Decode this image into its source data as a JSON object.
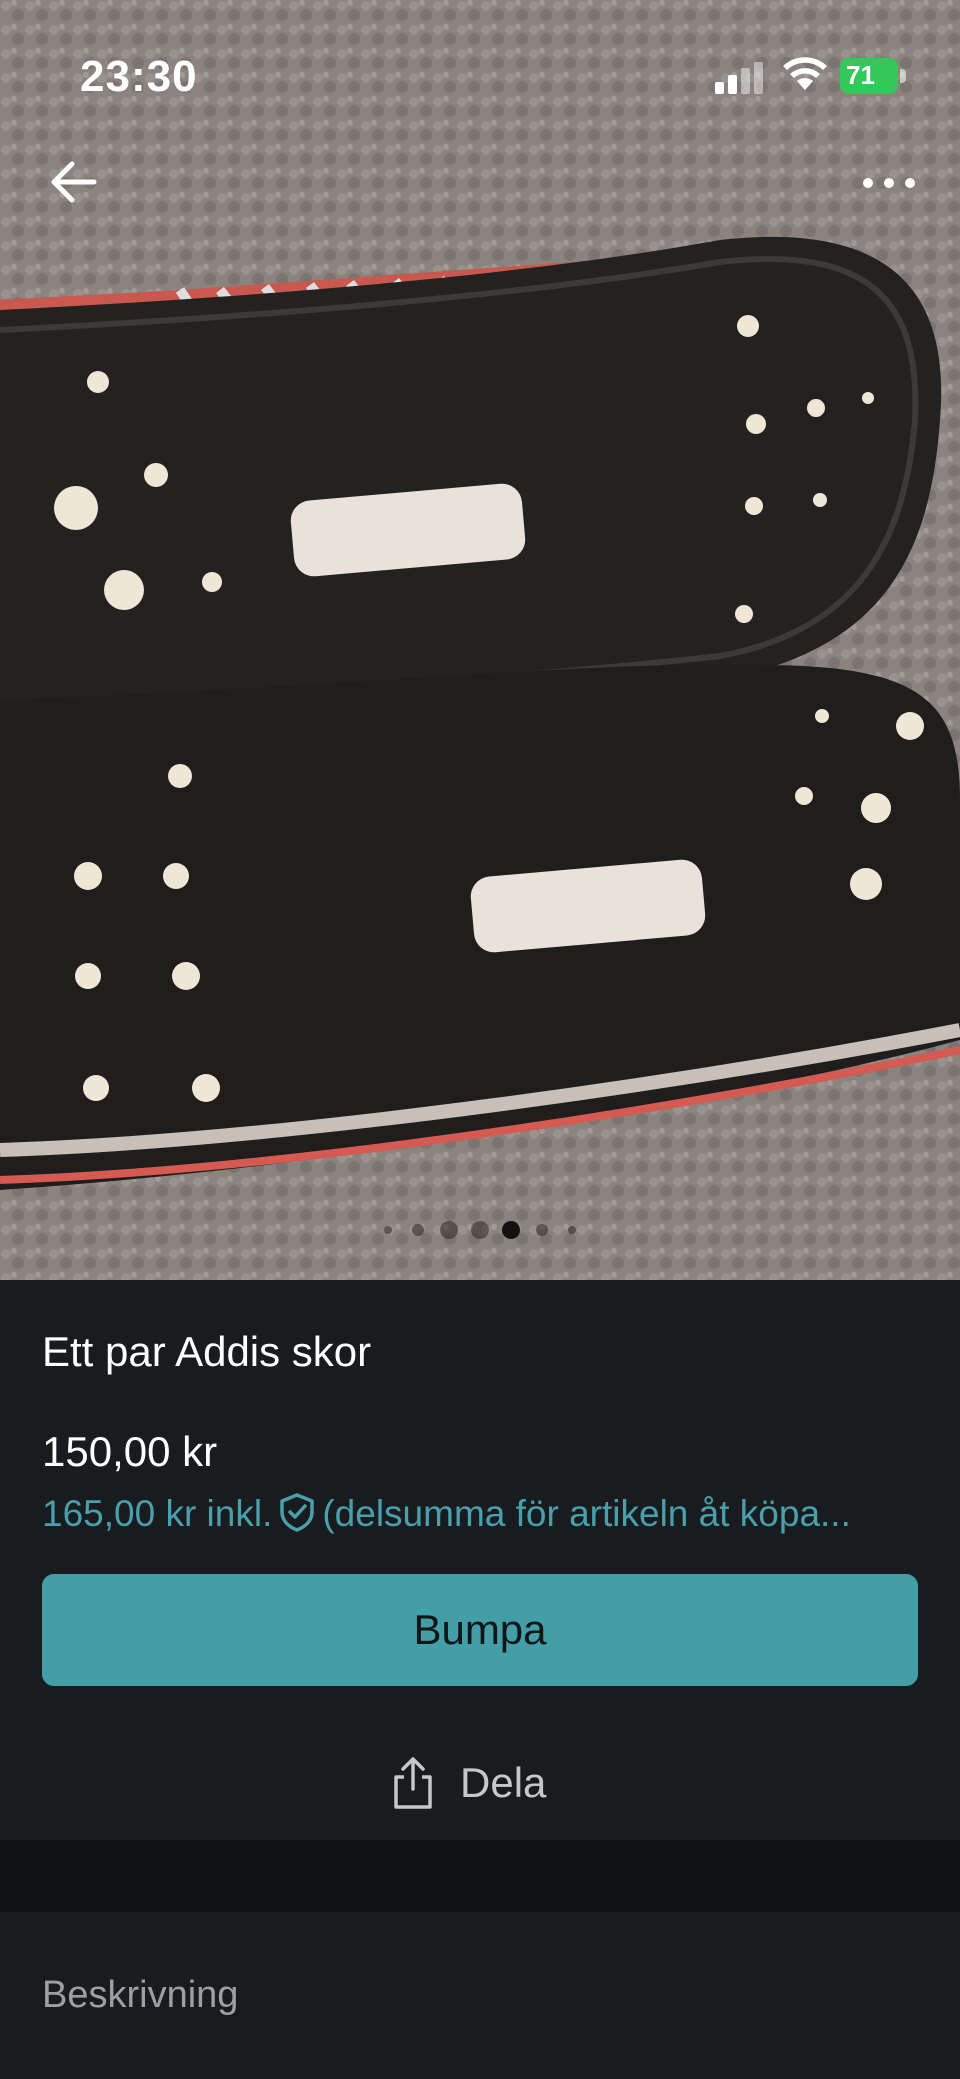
{
  "status_bar": {
    "time": "23:30",
    "battery_level": "71"
  },
  "photo": {
    "description_icon": "product-photo",
    "pager_total": 7,
    "pager_active_index": 4
  },
  "nav": {
    "back_icon": "arrow-left-icon",
    "more_icon": "ellipsis-icon"
  },
  "listing": {
    "title": "Ett par Addis skor",
    "price": "150,00 kr",
    "price_incl_prefix": "165,00 kr inkl.",
    "price_incl_suffix": "(delsumma för artikeln åt köpa..."
  },
  "actions": {
    "bump_label": "Bumpa",
    "share_label": "Dela"
  },
  "description": {
    "label": "Beskrivning"
  },
  "colors": {
    "accent": "#449ea8",
    "accent_text": "#4a9fad",
    "background": "#181c1f"
  }
}
